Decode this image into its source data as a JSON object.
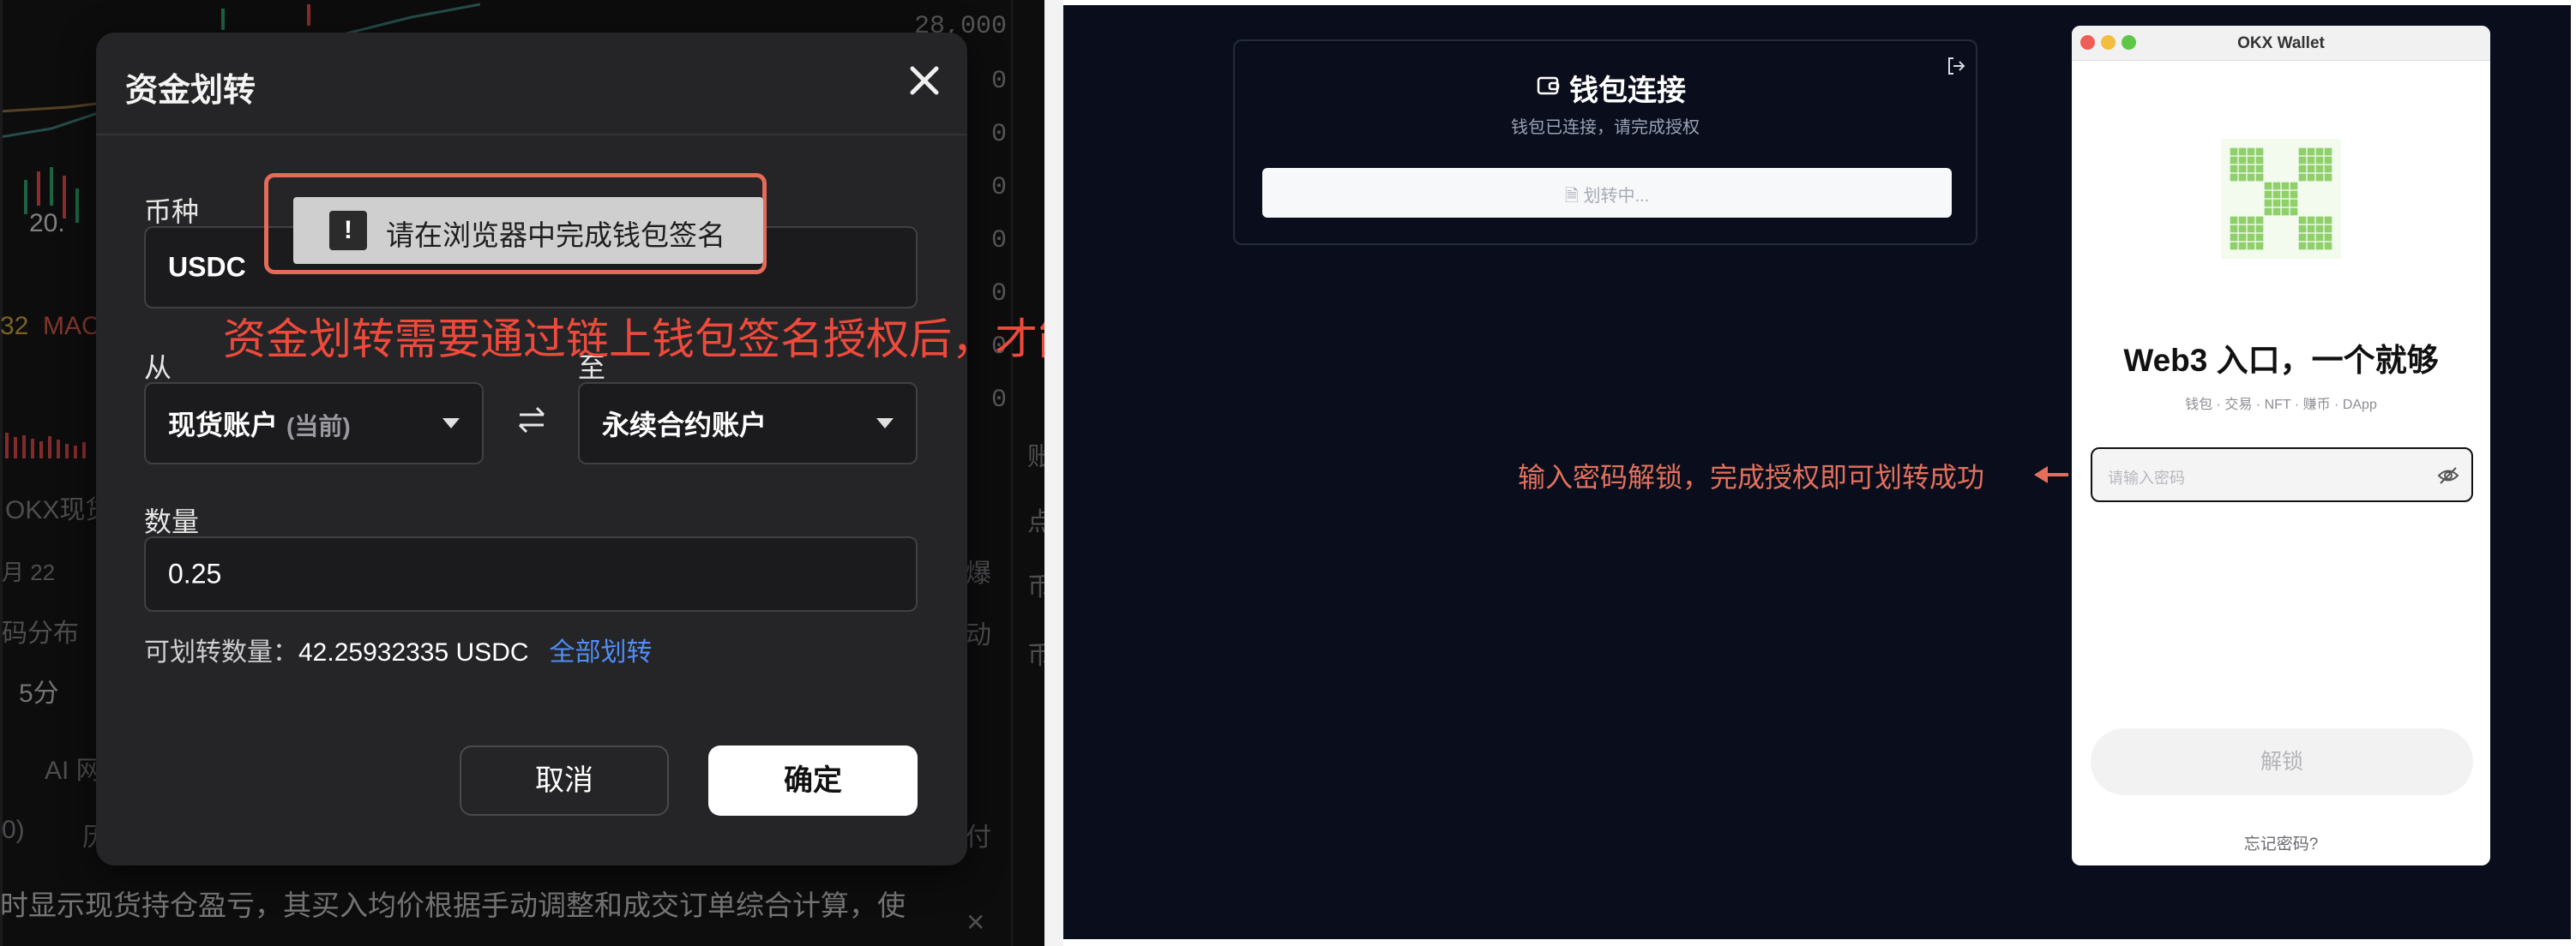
{
  "background": {
    "prices": [
      "28,000",
      "0",
      "0",
      "0",
      "0",
      "0",
      "0",
      "0"
    ],
    "price_fragment": "20.",
    "indicator_values": [
      "32",
      "MAC"
    ],
    "left_labels": [
      "OKX现货",
      "月 22",
      "码分布",
      "5分",
      "AI 网",
      "0)",
      "历"
    ],
    "right_fragments": [
      "账",
      "点",
      "币",
      "爆",
      "动",
      "币",
      "付"
    ],
    "footer_text": "时显示现货持仓盈亏，其买入均价根据手动调整和成交订单综合计算，使"
  },
  "modal": {
    "title": "资金划转",
    "currency_label": "币种",
    "currency_value": "USDC",
    "from_label": "从",
    "from_value": "现货账户",
    "from_tag": "(当前)",
    "to_label": "至",
    "to_value": "永续合约账户",
    "amount_label": "数量",
    "amount_value": "0.25",
    "available_label": "可划转数量：",
    "available_value": "42.25932335 USDC",
    "transfer_all": "全部划转",
    "cancel": "取消",
    "confirm": "确定"
  },
  "toast": {
    "icon": "!",
    "text": "请在浏览器中完成钱包签名"
  },
  "annotations": {
    "left": "资金划转需要通过链上钱包签名授权后，才能完成划转",
    "right": "输入密码解锁，完成授权即可划转成功"
  },
  "connect_card": {
    "title": "钱包连接",
    "subtitle": "钱包已连接，请完成授权",
    "button": "划转中..."
  },
  "wallet": {
    "window_title": "OKX Wallet",
    "headline": "Web3 入口，一个就够",
    "tagline": "钱包 · 交易 · NFT · 赚币 · DApp",
    "password_placeholder": "请输入密码",
    "unlock": "解锁",
    "forgot": "忘记密码?"
  },
  "colors": {
    "annotation_red": "#ee4a3c",
    "link_blue": "#4f8ef7",
    "okx_green": "#7ac74f"
  }
}
